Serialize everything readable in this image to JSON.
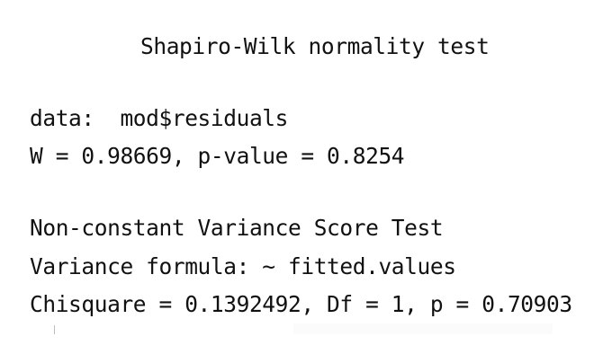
{
  "output": {
    "shapiro_title": "Shapiro-Wilk normality test",
    "data_line": "data:  mod$residuals",
    "w_line": "W = 0.98669, p-value = 0.8254",
    "ncv_title": "Non-constant Variance Score Test",
    "variance_formula_line": "Variance formula: ~ fitted.values",
    "chisquare_line": "Chisquare = 0.1392492, Df = 1, p = 0.70903"
  }
}
